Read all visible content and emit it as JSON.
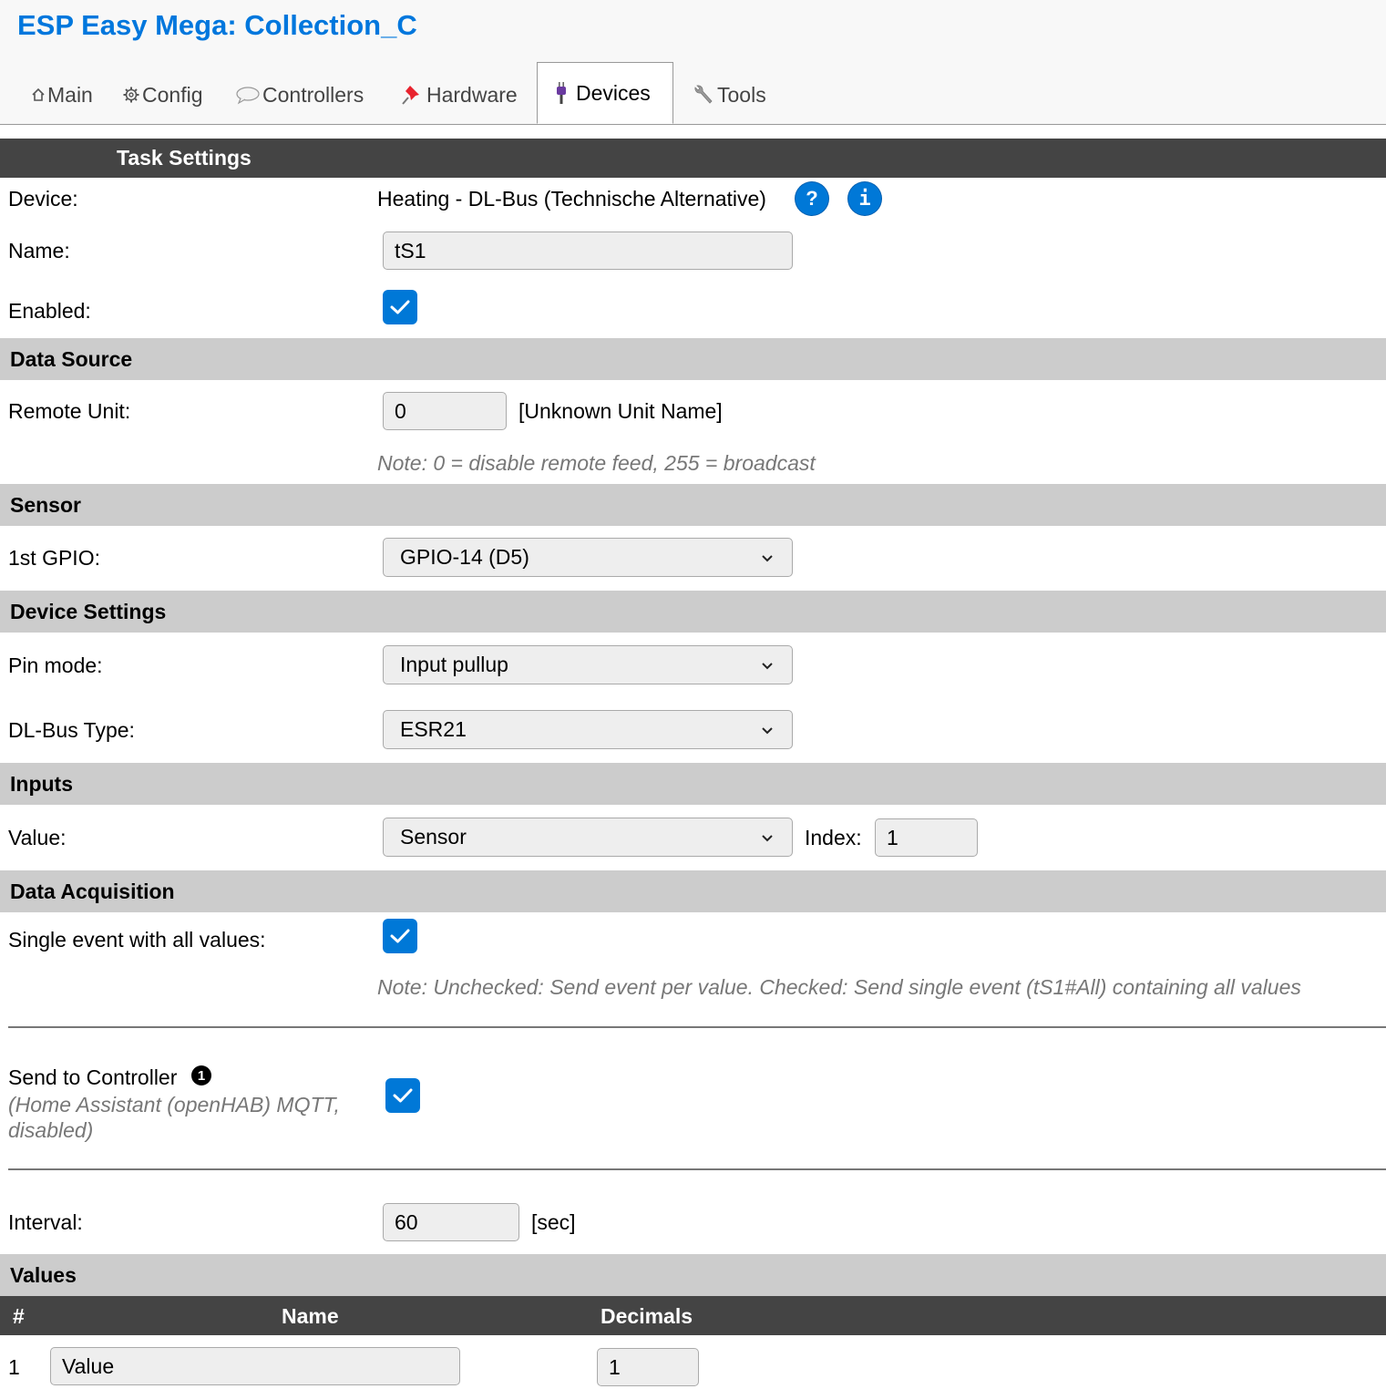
{
  "app": {
    "title": "ESP Easy Mega: Collection_C"
  },
  "tabs": [
    {
      "label": "Main",
      "icon": "home-icon"
    },
    {
      "label": "Config",
      "icon": "gear-icon"
    },
    {
      "label": "Controllers",
      "icon": "speech-bubble-icon"
    },
    {
      "label": "Hardware",
      "icon": "pushpin-icon"
    },
    {
      "label": "Devices",
      "icon": "plug-icon",
      "active": true
    },
    {
      "label": "Tools",
      "icon": "wrench-icon"
    }
  ],
  "task_settings": {
    "header": "Task Settings",
    "device_label": "Device:",
    "device_value": "Heating - DL-Bus (Technische Alternative)",
    "help_icon": "?",
    "info_icon": "i",
    "name_label": "Name:",
    "name_value": "tS1",
    "enabled_label": "Enabled:",
    "enabled": true
  },
  "data_source": {
    "header": "Data Source",
    "remote_unit_label": "Remote Unit:",
    "remote_unit_value": "0",
    "remote_unit_name": "[Unknown Unit Name]",
    "note": "Note: 0 = disable remote feed, 255 = broadcast"
  },
  "sensor": {
    "header": "Sensor",
    "gpio_label": "1st GPIO:",
    "gpio_value": "GPIO-14 (D5)"
  },
  "device_settings": {
    "header": "Device Settings",
    "pin_mode_label": "Pin mode:",
    "pin_mode_value": "Input pullup",
    "dlbus_type_label": "DL-Bus Type:",
    "dlbus_type_value": "ESR21"
  },
  "inputs": {
    "header": "Inputs",
    "value_label": "Value:",
    "value_select": "Sensor",
    "index_label": "Index:",
    "index_value": "1"
  },
  "data_acquisition": {
    "header": "Data Acquisition",
    "single_event_label": "Single event with all values:",
    "single_event": true,
    "note": "Note: Unchecked: Send event per value. Checked: Send single event (tS1#All) containing all values",
    "send_label": "Send to Controller",
    "send_badge": "1",
    "send_sub_line1": "(Home Assistant (openHAB) MQTT,",
    "send_sub_line2": "disabled)",
    "send_enabled": true,
    "interval_label": "Interval:",
    "interval_value": "60",
    "interval_unit": "[sec]"
  },
  "values": {
    "header": "Values",
    "columns": [
      "#",
      "Name",
      "Decimals"
    ],
    "rows": [
      {
        "index": "1",
        "name": "Value",
        "decimals": "1"
      }
    ]
  },
  "colors": {
    "title": "#0077dd",
    "dark_band": "#444444",
    "gray_band": "#cccccc",
    "accent": "#0078d7"
  }
}
